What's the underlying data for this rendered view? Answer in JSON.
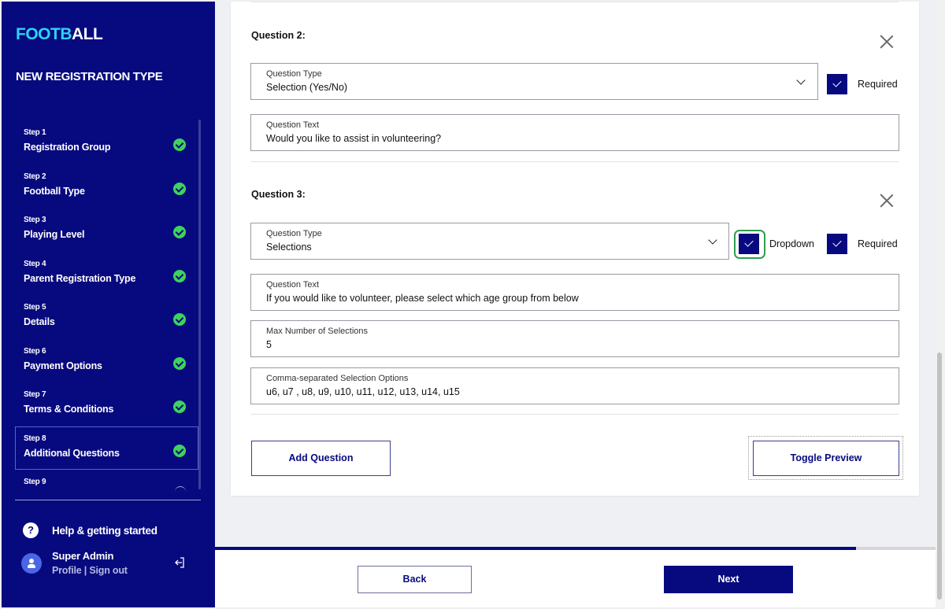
{
  "app": {
    "logo_part1": "FOOTB",
    "logo_part2": "ALL",
    "section_title": "NEW REGISTRATION TYPE"
  },
  "sidebar": {
    "steps": [
      {
        "num": "Step 1",
        "label": "Registration Group",
        "status": "complete"
      },
      {
        "num": "Step 2",
        "label": "Football Type",
        "status": "complete"
      },
      {
        "num": "Step 3",
        "label": "Playing Level",
        "status": "complete"
      },
      {
        "num": "Step 4",
        "label": "Parent Registration Type",
        "status": "complete"
      },
      {
        "num": "Step 5",
        "label": "Details",
        "status": "complete"
      },
      {
        "num": "Step 6",
        "label": "Payment Options",
        "status": "complete"
      },
      {
        "num": "Step 7",
        "label": "Terms & Conditions",
        "status": "complete"
      },
      {
        "num": "Step 8",
        "label": "Additional Questions",
        "status": "complete",
        "active": true
      },
      {
        "num": "Step 9",
        "label": "",
        "status": "loading"
      }
    ],
    "help_label": "Help & getting started",
    "user_name": "Super Admin",
    "profile_link": "Profile",
    "link_separator": " | ",
    "signout_link": "Sign out"
  },
  "questions": [
    {
      "title": "Question 2:",
      "type_label": "Question Type",
      "type_value": "Selection (Yes/No)",
      "required_label": "Required",
      "required_checked": true,
      "text_label": "Question Text",
      "text_value": "Would you like to assist in volunteering?"
    },
    {
      "title": "Question 3:",
      "type_label": "Question Type",
      "type_value": "Selections",
      "dropdown_label": "Dropdown",
      "dropdown_checked": true,
      "required_label": "Required",
      "required_checked": true,
      "text_label": "Question Text",
      "text_value": "If you would like to volunteer, please select which age group from below",
      "max_label": "Max Number of Selections",
      "max_value": "5",
      "options_label": "Comma-separated Selection Options",
      "options_value": "u6, u7 , u8, u9, u10, u11, u12, u13, u14, u15"
    }
  ],
  "actions": {
    "add_question": "Add Question",
    "toggle_preview": "Toggle Preview"
  },
  "footer": {
    "back": "Back",
    "next": "Next",
    "progress": 0.89
  },
  "colors": {
    "brand_navy": "#070a7e",
    "logo_cyan": "#2bd4f2",
    "check_green": "#3dd35c",
    "focus_ring": "#2e9e4e"
  }
}
